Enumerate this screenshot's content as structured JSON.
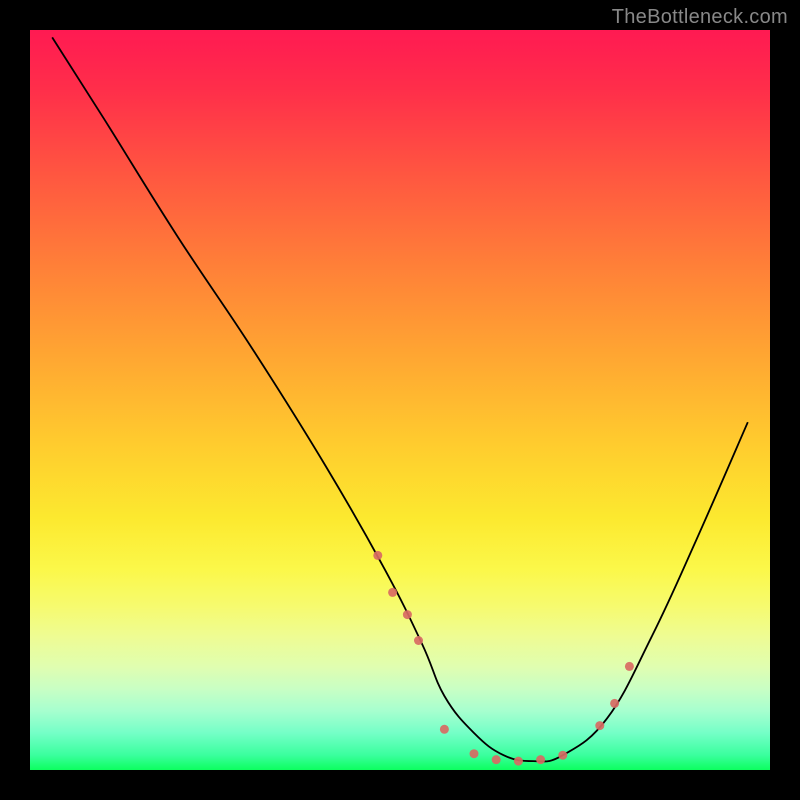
{
  "watermark": "TheBottleneck.com",
  "chart_data": {
    "type": "line",
    "title": "",
    "xlabel": "",
    "ylabel": "",
    "xlim": [
      0,
      100
    ],
    "ylim": [
      0,
      100
    ],
    "series": [
      {
        "name": "curve",
        "x": [
          3,
          10,
          20,
          30,
          40,
          48,
          53,
          56,
          60,
          64,
          68,
          72,
          78,
          84,
          90,
          97
        ],
        "values": [
          99,
          88,
          72,
          57,
          41,
          27,
          17,
          10,
          5,
          2,
          1.2,
          2,
          7,
          18,
          31,
          47
        ]
      }
    ],
    "markers": {
      "name": "highlighted-points",
      "x": [
        47,
        49,
        51,
        52.5,
        56,
        60,
        63,
        66,
        69,
        72,
        77,
        79,
        81
      ],
      "values": [
        29,
        24,
        21,
        17.5,
        5.5,
        2.2,
        1.4,
        1.2,
        1.4,
        2,
        6,
        9,
        14
      ],
      "marker_color": "#d86a63",
      "marker_size": 9
    },
    "gradient_background": {
      "orientation": "vertical",
      "stops": [
        {
          "pos": 0,
          "color": "#ff1a52"
        },
        {
          "pos": 50,
          "color": "#ffbb30"
        },
        {
          "pos": 78,
          "color": "#f4fc6a"
        },
        {
          "pos": 100,
          "color": "#0cff5f"
        }
      ]
    }
  }
}
